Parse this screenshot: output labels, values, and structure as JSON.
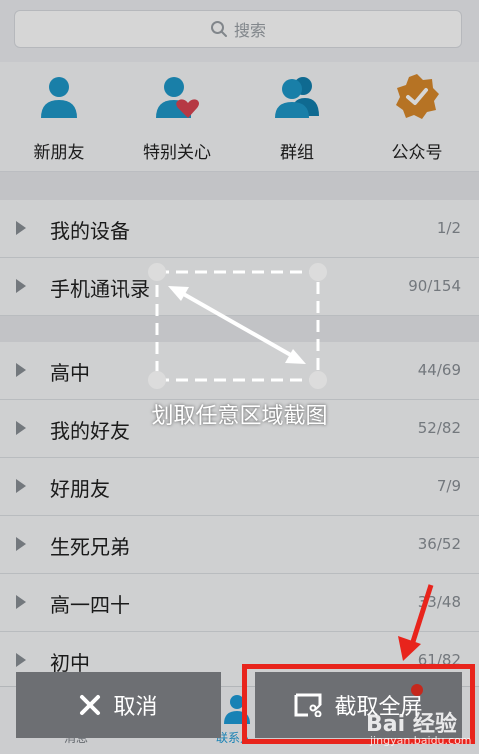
{
  "search": {
    "placeholder": "搜索"
  },
  "quick_entries": [
    {
      "label": "新朋友",
      "icon": "person-icon"
    },
    {
      "label": "特别关心",
      "icon": "person-heart-icon"
    },
    {
      "label": "群组",
      "icon": "group-icon"
    },
    {
      "label": "公众号",
      "icon": "badge-check-icon"
    }
  ],
  "groups": [
    {
      "name": "我的设备",
      "count": "1/2"
    },
    {
      "name": "手机通讯录",
      "count": "90/154"
    },
    {
      "name": "高中",
      "count": "44/69"
    },
    {
      "name": "我的好友",
      "count": "52/82"
    },
    {
      "name": "好朋友",
      "count": "7/9"
    },
    {
      "name": "生死兄弟",
      "count": "36/52"
    },
    {
      "name": "高一四十",
      "count": "33/48"
    },
    {
      "name": "初中",
      "count": "61/82"
    }
  ],
  "overlay": {
    "hint": "划取任意区域截图"
  },
  "tabbar": {
    "messages": "消息",
    "contacts": "联系人"
  },
  "actions": {
    "cancel": "取消",
    "full_screen": "截取全屏"
  },
  "watermark": {
    "logo": "Bai 经验",
    "url": "jingyan.baidu.com"
  },
  "colors": {
    "accent": "#1d9bd8",
    "highlight": "#e8241c",
    "badge": "#d98a2b",
    "heart": "#d94452"
  }
}
